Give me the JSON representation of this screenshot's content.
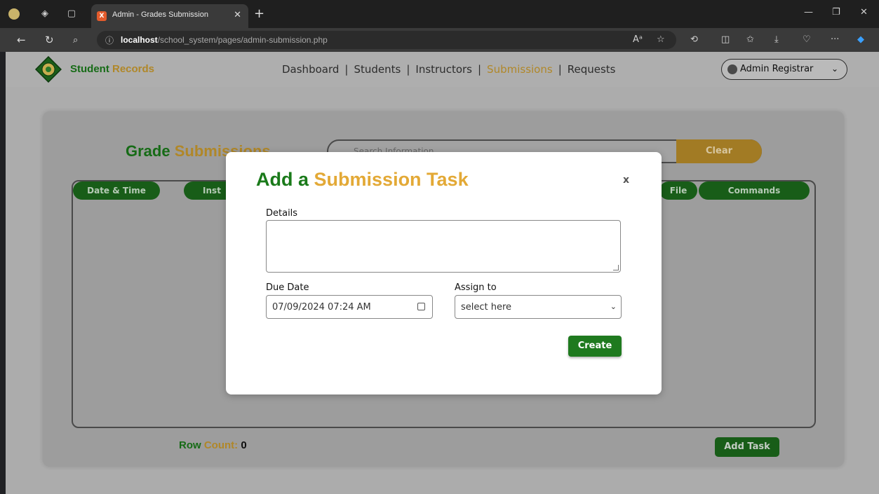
{
  "browser": {
    "tab_title": "Admin - Grades Submission",
    "url_host": "localhost",
    "url_path": "/school_system/pages/admin-submission.php"
  },
  "navbar": {
    "brand_first": "Student",
    "brand_second": "Records",
    "menu": [
      {
        "label": "Dashboard"
      },
      {
        "label": "Students"
      },
      {
        "label": "Instructors"
      },
      {
        "label": "Submissions"
      },
      {
        "label": "Requests"
      }
    ],
    "separator": "|",
    "user_label": "Admin Registrar"
  },
  "main": {
    "title_first": "Grade",
    "title_second": "Submissions",
    "search_placeholder": "Search Information",
    "clear_label": "Clear",
    "columns": [
      "Date & Time",
      "Inst",
      "File",
      "Commands"
    ],
    "row_count_label": "Row",
    "row_count_label2": "Count:",
    "row_count_value": "0",
    "add_task_label": "Add Task"
  },
  "modal": {
    "title_first": "Add a",
    "title_second": "Submission Task",
    "close_label": "x",
    "details_label": "Details",
    "due_date_label": "Due Date",
    "due_date_value": "07/09/2024 07:24 AM",
    "assign_label": "Assign to",
    "assign_value": "select here",
    "create_label": "Create"
  },
  "colors": {
    "green": "#1a7a1a",
    "gold": "#c99a2e"
  }
}
